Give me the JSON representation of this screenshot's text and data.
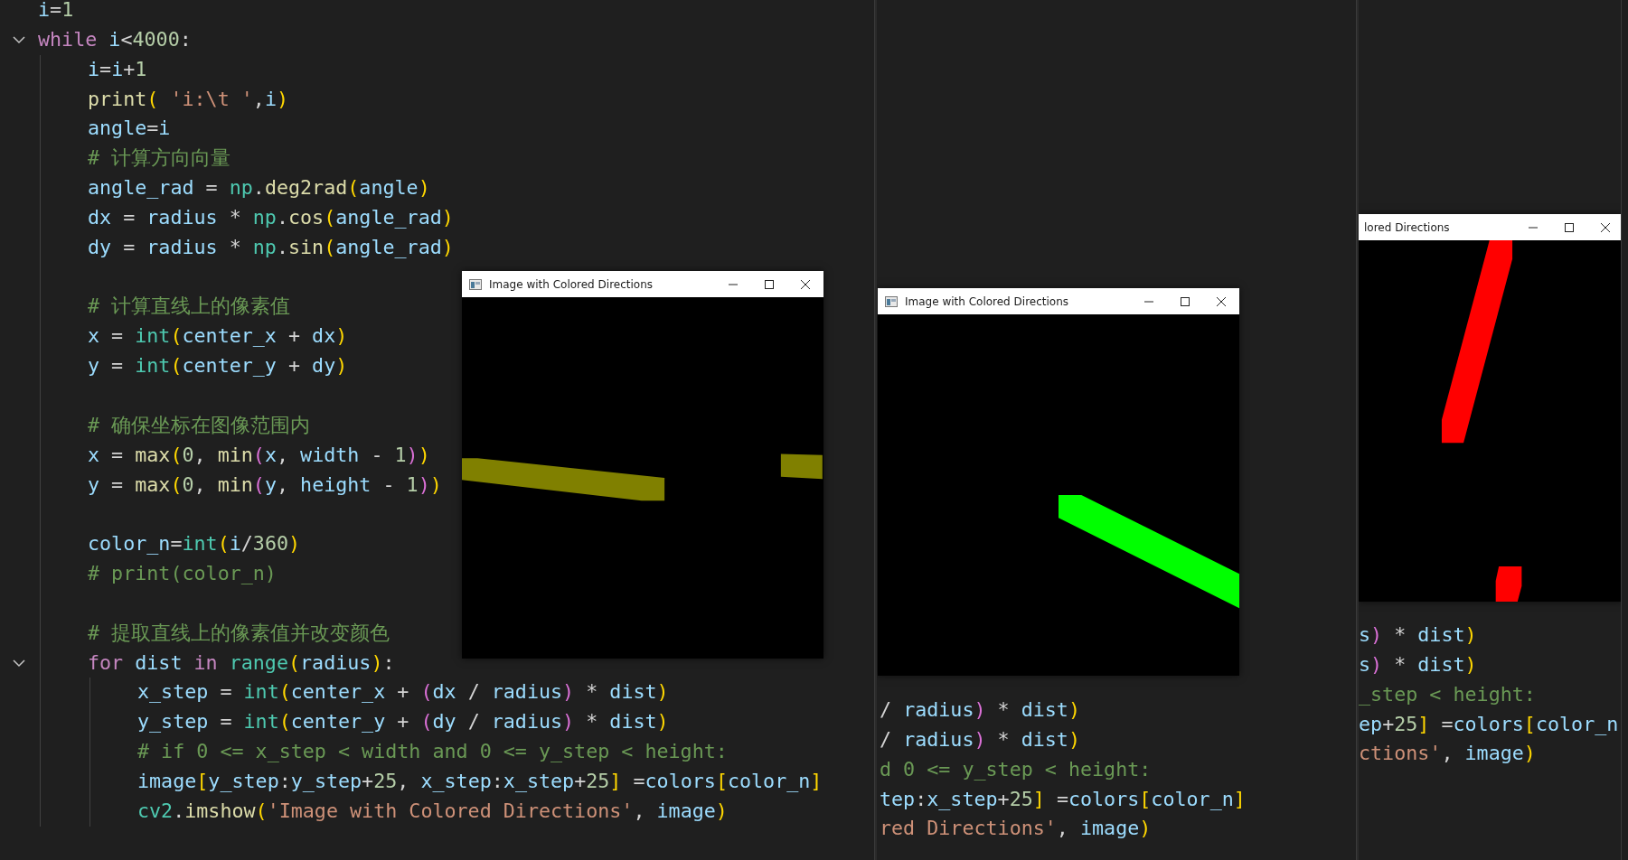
{
  "panels": [
    {
      "code": {
        "lines": [
          {
            "tokens": [
              {
                "text": "i",
                "kind": "var"
              },
              {
                "text": "=",
                "kind": "op"
              },
              {
                "text": "1",
                "kind": "num"
              }
            ]
          },
          {
            "expanded": true,
            "tokens": [
              {
                "text": "while ",
                "kind": "kw"
              },
              {
                "text": "i",
                "kind": "var"
              },
              {
                "text": "<",
                "kind": "op"
              },
              {
                "text": "4000",
                "kind": "num"
              },
              {
                "text": ":",
                "kind": "op"
              }
            ],
            "children": [
              {
                "tokens": [
                  {
                    "text": "i",
                    "kind": "var"
                  },
                  {
                    "text": "=",
                    "kind": "op"
                  },
                  {
                    "text": "i",
                    "kind": "var"
                  },
                  {
                    "text": "+",
                    "kind": "op"
                  },
                  {
                    "text": "1",
                    "kind": "num"
                  }
                ]
              },
              {
                "tokens": [
                  {
                    "text": "print",
                    "kind": "fn"
                  },
                  {
                    "text": "( ",
                    "kind": "b1"
                  },
                  {
                    "text": "'i:\\t '",
                    "kind": "str"
                  },
                  {
                    "text": ",",
                    "kind": "op"
                  },
                  {
                    "text": "i",
                    "kind": "var"
                  },
                  {
                    "text": ")",
                    "kind": "b1"
                  }
                ]
              },
              {
                "tokens": [
                  {
                    "text": "angle",
                    "kind": "var"
                  },
                  {
                    "text": "=",
                    "kind": "op"
                  },
                  {
                    "text": "i",
                    "kind": "var"
                  }
                ]
              },
              {
                "tokens": [
                  {
                    "text": "# 计算方向向量",
                    "kind": "cm"
                  }
                ]
              },
              {
                "tokens": [
                  {
                    "text": "angle_rad",
                    "kind": "var"
                  },
                  {
                    "text": " = ",
                    "kind": "op"
                  },
                  {
                    "text": "np",
                    "kind": "cls"
                  },
                  {
                    "text": ".",
                    "kind": "op"
                  },
                  {
                    "text": "deg2rad",
                    "kind": "fn"
                  },
                  {
                    "text": "(",
                    "kind": "b1"
                  },
                  {
                    "text": "angle",
                    "kind": "var"
                  },
                  {
                    "text": ")",
                    "kind": "b1"
                  }
                ]
              },
              {
                "tokens": [
                  {
                    "text": "dx",
                    "kind": "var"
                  },
                  {
                    "text": " = ",
                    "kind": "op"
                  },
                  {
                    "text": "radius",
                    "kind": "var"
                  },
                  {
                    "text": " * ",
                    "kind": "op"
                  },
                  {
                    "text": "np",
                    "kind": "cls"
                  },
                  {
                    "text": ".",
                    "kind": "op"
                  },
                  {
                    "text": "cos",
                    "kind": "fn"
                  },
                  {
                    "text": "(",
                    "kind": "b1"
                  },
                  {
                    "text": "angle_rad",
                    "kind": "var"
                  },
                  {
                    "text": ")",
                    "kind": "b1"
                  }
                ]
              },
              {
                "tokens": [
                  {
                    "text": "dy",
                    "kind": "var"
                  },
                  {
                    "text": " = ",
                    "kind": "op"
                  },
                  {
                    "text": "radius",
                    "kind": "var"
                  },
                  {
                    "text": " * ",
                    "kind": "op"
                  },
                  {
                    "text": "np",
                    "kind": "cls"
                  },
                  {
                    "text": ".",
                    "kind": "op"
                  },
                  {
                    "text": "sin",
                    "kind": "fn"
                  },
                  {
                    "text": "(",
                    "kind": "b1"
                  },
                  {
                    "text": "angle_rad",
                    "kind": "var"
                  },
                  {
                    "text": ")",
                    "kind": "b1"
                  }
                ]
              },
              {
                "gap_before": true,
                "tokens": [
                  {
                    "text": "# 计算直线上的像素值",
                    "kind": "cm"
                  }
                ]
              },
              {
                "tokens": [
                  {
                    "text": "x",
                    "kind": "var"
                  },
                  {
                    "text": " = ",
                    "kind": "op"
                  },
                  {
                    "text": "int",
                    "kind": "cls"
                  },
                  {
                    "text": "(",
                    "kind": "b1"
                  },
                  {
                    "text": "center_x",
                    "kind": "var"
                  },
                  {
                    "text": " + ",
                    "kind": "op"
                  },
                  {
                    "text": "dx",
                    "kind": "var"
                  },
                  {
                    "text": ")",
                    "kind": "b1"
                  }
                ]
              },
              {
                "tokens": [
                  {
                    "text": "y",
                    "kind": "var"
                  },
                  {
                    "text": " = ",
                    "kind": "op"
                  },
                  {
                    "text": "int",
                    "kind": "cls"
                  },
                  {
                    "text": "(",
                    "kind": "b1"
                  },
                  {
                    "text": "center_y",
                    "kind": "var"
                  },
                  {
                    "text": " + ",
                    "kind": "op"
                  },
                  {
                    "text": "dy",
                    "kind": "var"
                  },
                  {
                    "text": ")",
                    "kind": "b1"
                  }
                ]
              },
              {
                "gap_before": true,
                "tokens": [
                  {
                    "text": "# 确保坐标在图像范围内",
                    "kind": "cm"
                  }
                ]
              },
              {
                "tokens": [
                  {
                    "text": "x",
                    "kind": "var"
                  },
                  {
                    "text": " = ",
                    "kind": "op"
                  },
                  {
                    "text": "max",
                    "kind": "fn"
                  },
                  {
                    "text": "(",
                    "kind": "b1"
                  },
                  {
                    "text": "0",
                    "kind": "num"
                  },
                  {
                    "text": ", ",
                    "kind": "op"
                  },
                  {
                    "text": "min",
                    "kind": "fn"
                  },
                  {
                    "text": "(",
                    "kind": "b2"
                  },
                  {
                    "text": "x",
                    "kind": "var"
                  },
                  {
                    "text": ", ",
                    "kind": "op"
                  },
                  {
                    "text": "width",
                    "kind": "var"
                  },
                  {
                    "text": " - ",
                    "kind": "op"
                  },
                  {
                    "text": "1",
                    "kind": "num"
                  },
                  {
                    "text": ")",
                    "kind": "b2"
                  },
                  {
                    "text": ")",
                    "kind": "b1"
                  }
                ]
              },
              {
                "tokens": [
                  {
                    "text": "y",
                    "kind": "var"
                  },
                  {
                    "text": " = ",
                    "kind": "op"
                  },
                  {
                    "text": "max",
                    "kind": "fn"
                  },
                  {
                    "text": "(",
                    "kind": "b1"
                  },
                  {
                    "text": "0",
                    "kind": "num"
                  },
                  {
                    "text": ", ",
                    "kind": "op"
                  },
                  {
                    "text": "min",
                    "kind": "fn"
                  },
                  {
                    "text": "(",
                    "kind": "b2"
                  },
                  {
                    "text": "y",
                    "kind": "var"
                  },
                  {
                    "text": ", ",
                    "kind": "op"
                  },
                  {
                    "text": "height",
                    "kind": "var"
                  },
                  {
                    "text": " - ",
                    "kind": "op"
                  },
                  {
                    "text": "1",
                    "kind": "num"
                  },
                  {
                    "text": ")",
                    "kind": "b2"
                  },
                  {
                    "text": ")",
                    "kind": "b1"
                  }
                ]
              },
              {
                "gap_before": true,
                "tokens": [
                  {
                    "text": "color_n",
                    "kind": "var"
                  },
                  {
                    "text": "=",
                    "kind": "op"
                  },
                  {
                    "text": "int",
                    "kind": "cls"
                  },
                  {
                    "text": "(",
                    "kind": "b1"
                  },
                  {
                    "text": "i",
                    "kind": "var"
                  },
                  {
                    "text": "/",
                    "kind": "op"
                  },
                  {
                    "text": "360",
                    "kind": "num"
                  },
                  {
                    "text": ")",
                    "kind": "b1"
                  }
                ]
              },
              {
                "tokens": [
                  {
                    "text": "# print(color_n)",
                    "kind": "cm"
                  }
                ]
              },
              {
                "gap_before": true,
                "tokens": [
                  {
                    "text": "# 提取直线上的像素值并改变颜色",
                    "kind": "cm"
                  }
                ]
              },
              {
                "expanded": true,
                "tokens": [
                  {
                    "text": "for ",
                    "kind": "kw"
                  },
                  {
                    "text": "dist ",
                    "kind": "var"
                  },
                  {
                    "text": "in ",
                    "kind": "kw"
                  },
                  {
                    "text": "range",
                    "kind": "cls"
                  },
                  {
                    "text": "(",
                    "kind": "b1"
                  },
                  {
                    "text": "radius",
                    "kind": "var"
                  },
                  {
                    "text": ")",
                    "kind": "b1"
                  },
                  {
                    "text": ":",
                    "kind": "op"
                  }
                ],
                "children": [
                  {
                    "tokens": [
                      {
                        "text": "x_step",
                        "kind": "var"
                      },
                      {
                        "text": " = ",
                        "kind": "op"
                      },
                      {
                        "text": "int",
                        "kind": "cls"
                      },
                      {
                        "text": "(",
                        "kind": "b1"
                      },
                      {
                        "text": "center_x",
                        "kind": "var"
                      },
                      {
                        "text": " + ",
                        "kind": "op"
                      },
                      {
                        "text": "(",
                        "kind": "b2"
                      },
                      {
                        "text": "dx",
                        "kind": "var"
                      },
                      {
                        "text": " / ",
                        "kind": "op"
                      },
                      {
                        "text": "radius",
                        "kind": "var"
                      },
                      {
                        "text": ")",
                        "kind": "b2"
                      },
                      {
                        "text": " * ",
                        "kind": "op"
                      },
                      {
                        "text": "dist",
                        "kind": "var"
                      },
                      {
                        "text": ")",
                        "kind": "b1"
                      }
                    ]
                  },
                  {
                    "tokens": [
                      {
                        "text": "y_step",
                        "kind": "var"
                      },
                      {
                        "text": " = ",
                        "kind": "op"
                      },
                      {
                        "text": "int",
                        "kind": "cls"
                      },
                      {
                        "text": "(",
                        "kind": "b1"
                      },
                      {
                        "text": "center_y",
                        "kind": "var"
                      },
                      {
                        "text": " + ",
                        "kind": "op"
                      },
                      {
                        "text": "(",
                        "kind": "b2"
                      },
                      {
                        "text": "dy",
                        "kind": "var"
                      },
                      {
                        "text": " / ",
                        "kind": "op"
                      },
                      {
                        "text": "radius",
                        "kind": "var"
                      },
                      {
                        "text": ")",
                        "kind": "b2"
                      },
                      {
                        "text": " * ",
                        "kind": "op"
                      },
                      {
                        "text": "dist",
                        "kind": "var"
                      },
                      {
                        "text": ")",
                        "kind": "b1"
                      }
                    ]
                  },
                  {
                    "tokens": [
                      {
                        "text": "# if 0 <= x_step < width and 0 <= y_step < height:",
                        "kind": "cm"
                      }
                    ]
                  },
                  {
                    "tokens": [
                      {
                        "text": "image",
                        "kind": "var"
                      },
                      {
                        "text": "[",
                        "kind": "b1"
                      },
                      {
                        "text": "y_step",
                        "kind": "var"
                      },
                      {
                        "text": ":",
                        "kind": "op"
                      },
                      {
                        "text": "y_step",
                        "kind": "var"
                      },
                      {
                        "text": "+",
                        "kind": "op"
                      },
                      {
                        "text": "25",
                        "kind": "num"
                      },
                      {
                        "text": ", ",
                        "kind": "op"
                      },
                      {
                        "text": "x_step",
                        "kind": "var"
                      },
                      {
                        "text": ":",
                        "kind": "op"
                      },
                      {
                        "text": "x_step",
                        "kind": "var"
                      },
                      {
                        "text": "+",
                        "kind": "op"
                      },
                      {
                        "text": "25",
                        "kind": "num"
                      },
                      {
                        "text": "]",
                        "kind": "b1"
                      },
                      {
                        "text": " =",
                        "kind": "op"
                      },
                      {
                        "text": "colors",
                        "kind": "var"
                      },
                      {
                        "text": "[",
                        "kind": "b1"
                      },
                      {
                        "text": "color_n",
                        "kind": "var"
                      },
                      {
                        "text": "]",
                        "kind": "b1"
                      }
                    ]
                  },
                  {
                    "tokens": [
                      {
                        "text": "cv2",
                        "kind": "cls"
                      },
                      {
                        "text": ".",
                        "kind": "op"
                      },
                      {
                        "text": "imshow",
                        "kind": "fn"
                      },
                      {
                        "text": "(",
                        "kind": "b1"
                      },
                      {
                        "text": "'Image with Colored Directions'",
                        "kind": "str"
                      },
                      {
                        "text": ", ",
                        "kind": "op"
                      },
                      {
                        "text": "image",
                        "kind": "var"
                      },
                      {
                        "text": ")",
                        "kind": "b1"
                      }
                    ]
                  }
                ]
              }
            ]
          }
        ]
      },
      "window": {
        "title": "Image with Colored Directions",
        "clipped": false,
        "color": "#808000"
      }
    },
    {
      "code": {
        "lines": [
          {
            "tokens": [
              {
                "text": "/ ",
                "kind": "op"
              },
              {
                "text": "radius",
                "kind": "var"
              },
              {
                "text": ")",
                "kind": "b2"
              },
              {
                "text": " * ",
                "kind": "op"
              },
              {
                "text": "dist",
                "kind": "var"
              },
              {
                "text": ")",
                "kind": "b1"
              }
            ]
          },
          {
            "tokens": [
              {
                "text": "/ ",
                "kind": "op"
              },
              {
                "text": "radius",
                "kind": "var"
              },
              {
                "text": ")",
                "kind": "b2"
              },
              {
                "text": " * ",
                "kind": "op"
              },
              {
                "text": "dist",
                "kind": "var"
              },
              {
                "text": ")",
                "kind": "b1"
              }
            ]
          },
          {
            "tokens": [
              {
                "text": "d 0 <= y_step < height:",
                "kind": "cm"
              }
            ]
          },
          {
            "tokens": [
              {
                "text": "tep",
                "kind": "var"
              },
              {
                "text": ":",
                "kind": "op"
              },
              {
                "text": "x_step",
                "kind": "var"
              },
              {
                "text": "+",
                "kind": "op"
              },
              {
                "text": "25",
                "kind": "num"
              },
              {
                "text": "]",
                "kind": "b1"
              },
              {
                "text": " =",
                "kind": "op"
              },
              {
                "text": "colors",
                "kind": "var"
              },
              {
                "text": "[",
                "kind": "b1"
              },
              {
                "text": "color_n",
                "kind": "var"
              },
              {
                "text": "]",
                "kind": "b1"
              }
            ]
          },
          {
            "tokens": [
              {
                "text": "red Directions'",
                "kind": "str"
              },
              {
                "text": ", ",
                "kind": "op"
              },
              {
                "text": "image",
                "kind": "var"
              },
              {
                "text": ")",
                "kind": "b1"
              }
            ]
          }
        ]
      },
      "window": {
        "title": "Image with Colored Directions",
        "clipped": false,
        "color": "#00ff00"
      }
    },
    {
      "code": {
        "lines": [
          {
            "tokens": [
              {
                "text": "s",
                "kind": "var"
              },
              {
                "text": ")",
                "kind": "b2"
              },
              {
                "text": " * ",
                "kind": "op"
              },
              {
                "text": "dist",
                "kind": "var"
              },
              {
                "text": ")",
                "kind": "b1"
              }
            ]
          },
          {
            "tokens": [
              {
                "text": "s",
                "kind": "var"
              },
              {
                "text": ")",
                "kind": "b2"
              },
              {
                "text": " * ",
                "kind": "op"
              },
              {
                "text": "dist",
                "kind": "var"
              },
              {
                "text": ")",
                "kind": "b1"
              }
            ]
          },
          {
            "tokens": [
              {
                "text": "_step < height:",
                "kind": "cm"
              }
            ]
          },
          {
            "tokens": [
              {
                "text": "ep",
                "kind": "var"
              },
              {
                "text": "+",
                "kind": "op"
              },
              {
                "text": "25",
                "kind": "num"
              },
              {
                "text": "]",
                "kind": "b1"
              },
              {
                "text": " =",
                "kind": "op"
              },
              {
                "text": "colors",
                "kind": "var"
              },
              {
                "text": "[",
                "kind": "b1"
              },
              {
                "text": "color_n",
                "kind": "var"
              }
            ]
          },
          {
            "tokens": [
              {
                "text": "ctions'",
                "kind": "str"
              },
              {
                "text": ", ",
                "kind": "op"
              },
              {
                "text": "image",
                "kind": "var"
              },
              {
                "text": ")",
                "kind": "b1"
              }
            ]
          }
        ]
      },
      "window": {
        "title": "lored Directions",
        "clipped": true,
        "color": "#ff0000"
      }
    }
  ]
}
